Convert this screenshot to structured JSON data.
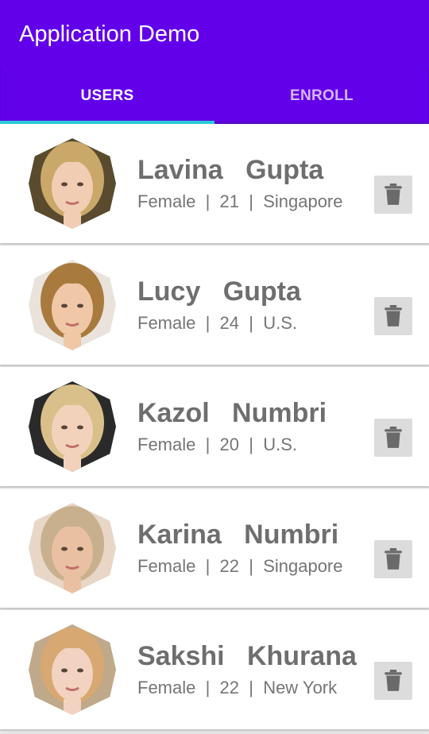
{
  "app": {
    "title": "Application Demo"
  },
  "tabs": [
    {
      "label": "USERS",
      "active": true
    },
    {
      "label": "ENROLL",
      "active": false
    }
  ],
  "colors": {
    "primary": "#6200ea",
    "tab_indicator": "#29c9d9",
    "text": "#6e6e6e",
    "delete_bg": "#dcdcdc",
    "delete_icon": "#6a6a6a"
  },
  "users": [
    {
      "first": "Lavina",
      "last": "Gupta",
      "gender": "Female",
      "age": "21",
      "location": "Singapore",
      "avatar": "avatar-photo-icon",
      "delete_icon": "trash-icon"
    },
    {
      "first": "Lucy",
      "last": "Gupta",
      "gender": "Female",
      "age": "24",
      "location": "U.S.",
      "avatar": "avatar-photo-icon",
      "delete_icon": "trash-icon"
    },
    {
      "first": "Kazol",
      "last": "Numbri",
      "gender": "Female",
      "age": "20",
      "location": "U.S.",
      "avatar": "avatar-photo-icon",
      "delete_icon": "trash-icon"
    },
    {
      "first": "Karina",
      "last": "Numbri",
      "gender": "Female",
      "age": "22",
      "location": "Singapore",
      "avatar": "avatar-photo-icon",
      "delete_icon": "trash-icon"
    },
    {
      "first": "Sakshi",
      "last": "Khurana",
      "gender": "Female",
      "age": "22",
      "location": "New York",
      "avatar": "avatar-photo-icon",
      "delete_icon": "trash-icon"
    }
  ]
}
